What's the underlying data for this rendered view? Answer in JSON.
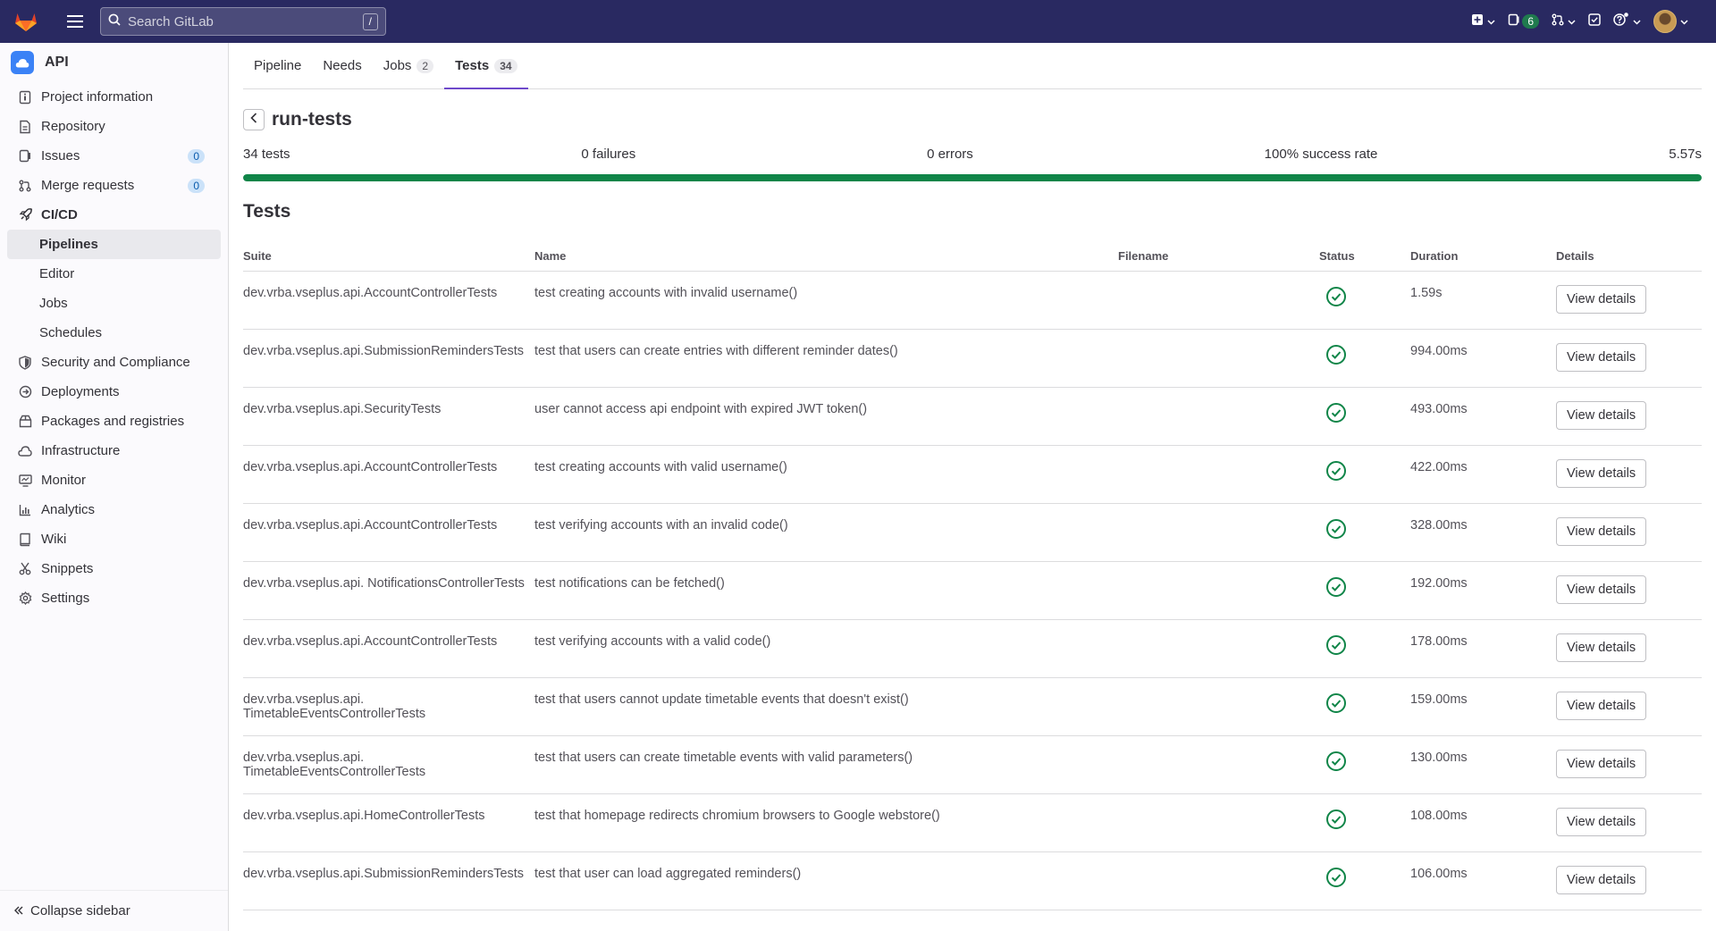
{
  "topbar": {
    "search_placeholder": "Search GitLab",
    "search_shortcut": "/",
    "issues_badge": "6",
    "colors": {
      "bg": "#292961"
    },
    "icons": [
      "gitlab-logo",
      "hamburger-icon",
      "search-icon",
      "plus-square-icon",
      "issues-icon",
      "merge-request-icon",
      "todo-icon",
      "help-icon",
      "avatar"
    ]
  },
  "sidebar": {
    "project_name": "API",
    "items": [
      {
        "label": "Project information",
        "icon": "info-icon"
      },
      {
        "label": "Repository",
        "icon": "doc-icon"
      },
      {
        "label": "Issues",
        "icon": "issues-icon",
        "count": "0"
      },
      {
        "label": "Merge requests",
        "icon": "merge-request-icon",
        "count": "0"
      },
      {
        "label": "CI/CD",
        "icon": "rocket-icon"
      },
      {
        "label": "Pipelines"
      },
      {
        "label": "Editor"
      },
      {
        "label": "Jobs"
      },
      {
        "label": "Schedules"
      },
      {
        "label": "Security and Compliance",
        "icon": "shield-icon"
      },
      {
        "label": "Deployments",
        "icon": "deployments-icon"
      },
      {
        "label": "Packages and registries",
        "icon": "package-icon"
      },
      {
        "label": "Infrastructure",
        "icon": "cloud-icon"
      },
      {
        "label": "Monitor",
        "icon": "monitor-icon"
      },
      {
        "label": "Analytics",
        "icon": "chart-icon"
      },
      {
        "label": "Wiki",
        "icon": "book-icon"
      },
      {
        "label": "Snippets",
        "icon": "scissors-icon"
      },
      {
        "label": "Settings",
        "icon": "gear-icon"
      }
    ],
    "collapse_label": "Collapse sidebar"
  },
  "tabs": [
    {
      "label": "Pipeline"
    },
    {
      "label": "Needs"
    },
    {
      "label": "Jobs",
      "count": "2"
    },
    {
      "label": "Tests",
      "count": "34",
      "active": true
    }
  ],
  "job": {
    "title": "run-tests",
    "tests": "34 tests",
    "failures": "0 failures",
    "errors": "0 errors",
    "success_rate": "100% success rate",
    "duration": "5.57s",
    "progress_fraction": 1.0
  },
  "tests_section": {
    "title": "Tests",
    "columns": [
      "Suite",
      "Name",
      "Filename",
      "Status",
      "Duration",
      "Details"
    ],
    "rows": [
      {
        "suite": "dev.vrba.vseplus.api.AccountControllerTests",
        "name": "test creating accounts with invalid username()",
        "filename": "",
        "duration": "1.59s",
        "details": "View details"
      },
      {
        "suite": "dev.vrba.vseplus.api.SubmissionRemindersTests",
        "name": "test that users can create entries with different reminder dates()",
        "filename": "",
        "duration": "994.00ms",
        "details": "View details"
      },
      {
        "suite": "dev.vrba.vseplus.api.SecurityTests",
        "name": "user cannot access api endpoint with expired JWT token()",
        "filename": "",
        "duration": "493.00ms",
        "details": "View details"
      },
      {
        "suite": "dev.vrba.vseplus.api.AccountControllerTests",
        "name": "test creating accounts with valid username()",
        "filename": "",
        "duration": "422.00ms",
        "details": "View details"
      },
      {
        "suite": "dev.vrba.vseplus.api.AccountControllerTests",
        "name": "test verifying accounts with an invalid code()",
        "filename": "",
        "duration": "328.00ms",
        "details": "View details"
      },
      {
        "suite": "dev.vrba.vseplus.api. NotificationsControllerTests",
        "name": "test notifications can be fetched()",
        "filename": "",
        "duration": "192.00ms",
        "details": "View details"
      },
      {
        "suite": "dev.vrba.vseplus.api.AccountControllerTests",
        "name": "test verifying accounts with a valid code()",
        "filename": "",
        "duration": "178.00ms",
        "details": "View details"
      },
      {
        "suite": "dev.vrba.vseplus.api. TimetableEventsControllerTests",
        "name": "test that users cannot update timetable events that doesn't exist()",
        "filename": "",
        "duration": "159.00ms",
        "details": "View details"
      },
      {
        "suite": "dev.vrba.vseplus.api. TimetableEventsControllerTests",
        "name": "test that users can create timetable events with valid parameters()",
        "filename": "",
        "duration": "130.00ms",
        "details": "View details"
      },
      {
        "suite": "dev.vrba.vseplus.api.HomeControllerTests",
        "name": "test that homepage redirects chromium browsers to Google webstore()",
        "filename": "",
        "duration": "108.00ms",
        "details": "View details"
      },
      {
        "suite": "dev.vrba.vseplus.api.SubmissionRemindersTests",
        "name": "test that user can load aggregated reminders()",
        "filename": "",
        "duration": "106.00ms",
        "details": "View details"
      }
    ]
  }
}
